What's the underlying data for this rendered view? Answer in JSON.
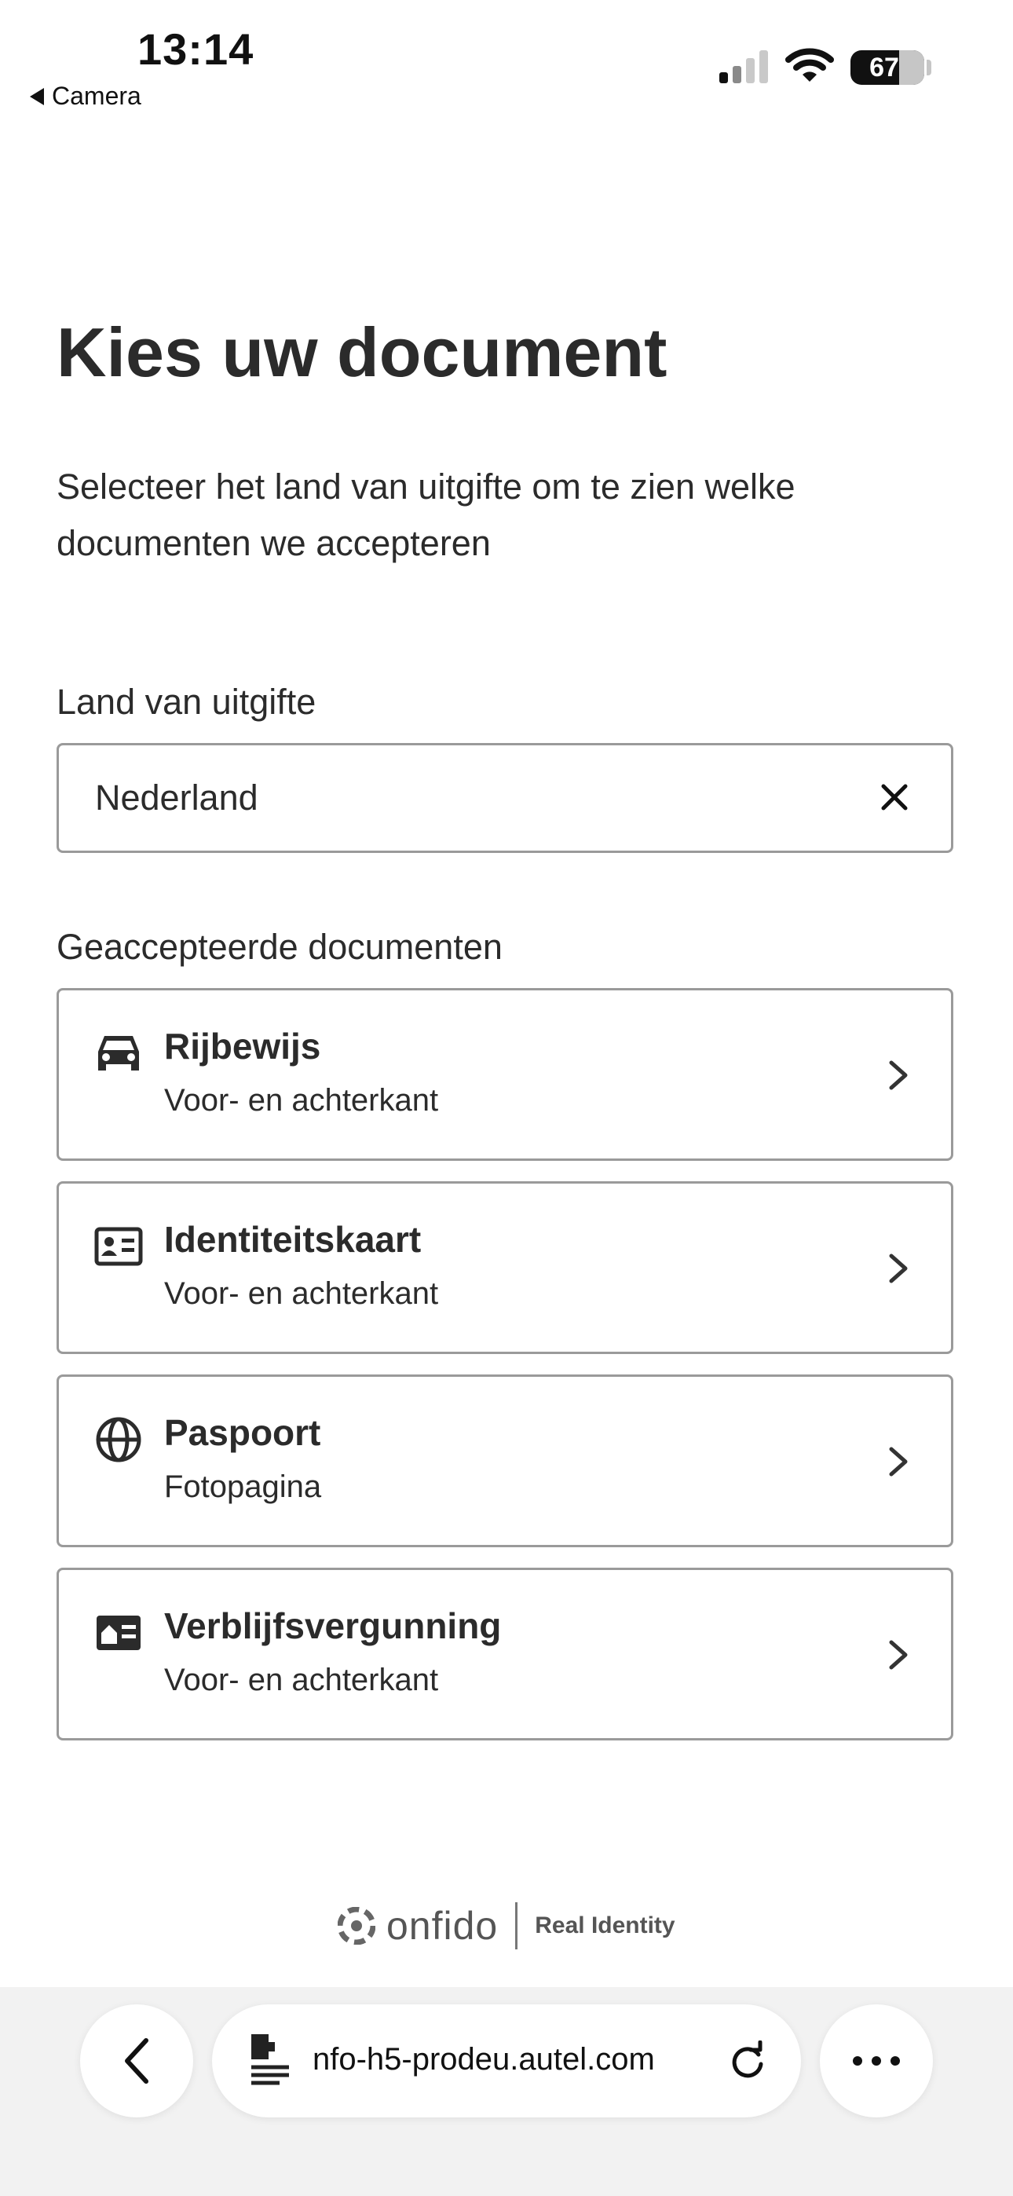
{
  "status_bar": {
    "time": "13:14",
    "back_app": "Camera",
    "battery": "67"
  },
  "page": {
    "title": "Kies uw document",
    "subtitle": "Selecteer het land van uitgifte om te zien welke documenten we accepteren",
    "country_label": "Land van uitgifte",
    "country_value": "Nederland",
    "documents_label": "Geaccepteerde documenten"
  },
  "documents": [
    {
      "title": "Rijbewijs",
      "subtitle": "Voor- en achterkant",
      "icon": "car-icon"
    },
    {
      "title": "Identiteitskaart",
      "subtitle": "Voor- en achterkant",
      "icon": "id-card-icon"
    },
    {
      "title": "Paspoort",
      "subtitle": "Fotopagina",
      "icon": "globe-icon"
    },
    {
      "title": "Verblijfsvergunning",
      "subtitle": "Voor- en achterkant",
      "icon": "residence-card-icon"
    }
  ],
  "footer": {
    "brand": "onfido",
    "tagline": "Real Identity"
  },
  "browser": {
    "url": "nfo-h5-prodeu.autel.com"
  },
  "colors": {
    "text": "#2b2b2b",
    "border": "#9a9a9a",
    "browser_bg": "#f2f2f2"
  }
}
